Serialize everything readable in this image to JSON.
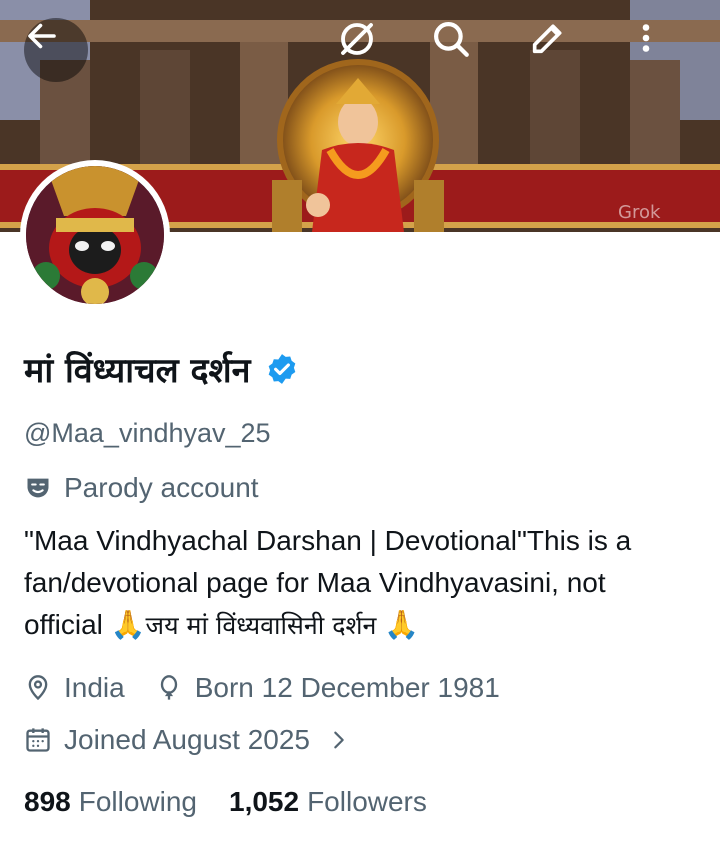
{
  "header": {
    "back_icon": "arrow-left-icon",
    "history_icon": "history-slash-icon",
    "search_icon": "search-icon",
    "edit_icon": "edit-pencil-icon",
    "more_icon": "more-vertical-icon",
    "banner_watermark": "Grok"
  },
  "profile": {
    "display_name": "मां विंध्याचल दर्शन",
    "verified": true,
    "handle": "@Maa_vindhyav_25",
    "parody_label": "Parody account",
    "bio_line1": "\"Maa Vindhyachal Darshan | Devotional\"This is a",
    "bio_line2": "fan/devotional page for Maa Vindhyavasini, not",
    "bio_line3_text": "official ",
    "bio_emoji": "🙏",
    "bio_hindi": "जय मां विंध्यवासिनी दर्शन ",
    "location": "India",
    "born": "Born 12 December 1981",
    "joined": "Joined August 2025",
    "following_count": "898",
    "following_label": "Following",
    "followers_count": "1,052",
    "followers_label": "Followers"
  },
  "colors": {
    "text_primary": "#0f1419",
    "text_secondary": "#536471",
    "verified_blue": "#1d9bf0"
  }
}
